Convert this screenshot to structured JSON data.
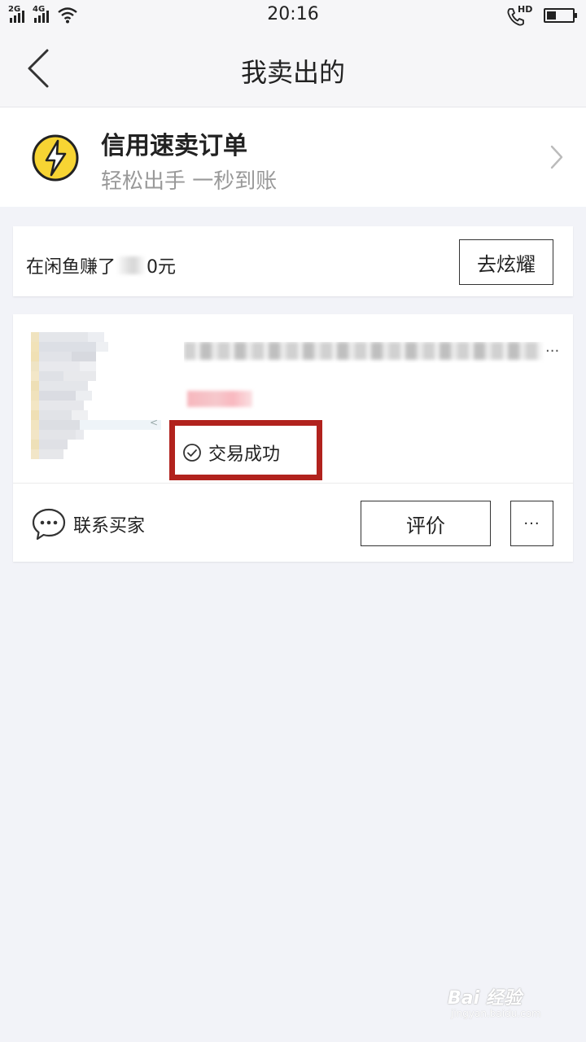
{
  "status_bar": {
    "network1": "2G",
    "network2": "4G",
    "time": "20:16",
    "call_hd": "HD",
    "battery_level": 0.35
  },
  "nav": {
    "title": "我卖出的"
  },
  "credit_banner": {
    "title": "信用速卖订单",
    "subtitle": "轻松出手 一秒到账"
  },
  "earned": {
    "prefix": "在闲鱼赚了",
    "suffix": "0元",
    "button": "去炫耀"
  },
  "order": {
    "title_ellipsis": "...",
    "status": "交易成功",
    "contact_label": "联系买家",
    "review_button": "评价",
    "more_button": "···"
  },
  "watermark": {
    "main": "Bai 经验",
    "sub": "jingyan.baidu.com"
  },
  "colors": {
    "highlight": "#b1221d",
    "bolt_yellow": "#f7d433",
    "background": "#f2f3f8"
  }
}
